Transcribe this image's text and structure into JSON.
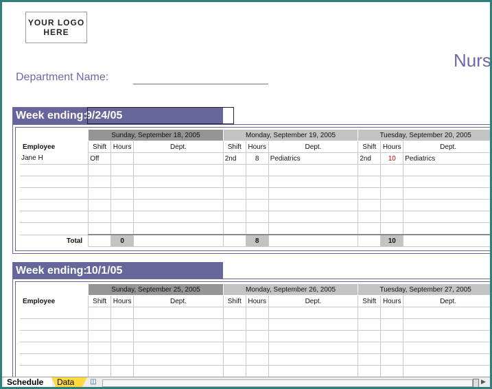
{
  "logo_text": "YOUR LOGO\nHERE",
  "title": "Nurs",
  "department_label": "Department Name:",
  "subheaders": {
    "employee": "Employee",
    "shift": "Shift",
    "hours": "Hours",
    "dept": "Dept.",
    "total": "Total"
  },
  "weeks": [
    {
      "week_label": "Week ending:",
      "date": "9/24/05",
      "days": [
        "Sunday, September 18, 2005",
        "Monday, September 19, 2005",
        "Tuesday, September 20, 2005"
      ],
      "rows": [
        [
          "Jane H",
          "Off",
          "",
          "",
          "2nd",
          "8",
          "Pediatrics",
          "2nd",
          "10",
          "Pediatrics"
        ],
        [
          "",
          "",
          "",
          "",
          "",
          "",
          "",
          "",
          "",
          ""
        ],
        [
          "",
          "",
          "",
          "",
          "",
          "",
          "",
          "",
          "",
          ""
        ],
        [
          "",
          "",
          "",
          "",
          "",
          "",
          "",
          "",
          "",
          ""
        ],
        [
          "",
          "",
          "",
          "",
          "",
          "",
          "",
          "",
          "",
          ""
        ],
        [
          "",
          "",
          "",
          "",
          "",
          "",
          "",
          "",
          "",
          ""
        ],
        [
          "",
          "",
          "",
          "",
          "",
          "",
          "",
          "",
          "",
          ""
        ]
      ],
      "totals": [
        "0",
        "8",
        "10"
      ]
    },
    {
      "week_label": "Week ending:",
      "date": "10/1/05",
      "days": [
        "Sunday, September 25, 2005",
        "Monday, September 26, 2005",
        "Tuesday, September 27, 2005"
      ]
    }
  ],
  "sheet_tabs": {
    "schedule": "Schedule",
    "data": "Data"
  },
  "colors": {
    "accent": "#66669a",
    "title": "#6a6aa8",
    "day_header_dark": "#959595",
    "day_header_light": "#c3c3c3",
    "data_tab": "#ffd940",
    "highlight_hours": "#dd0000",
    "background": "#2e7f7a"
  }
}
